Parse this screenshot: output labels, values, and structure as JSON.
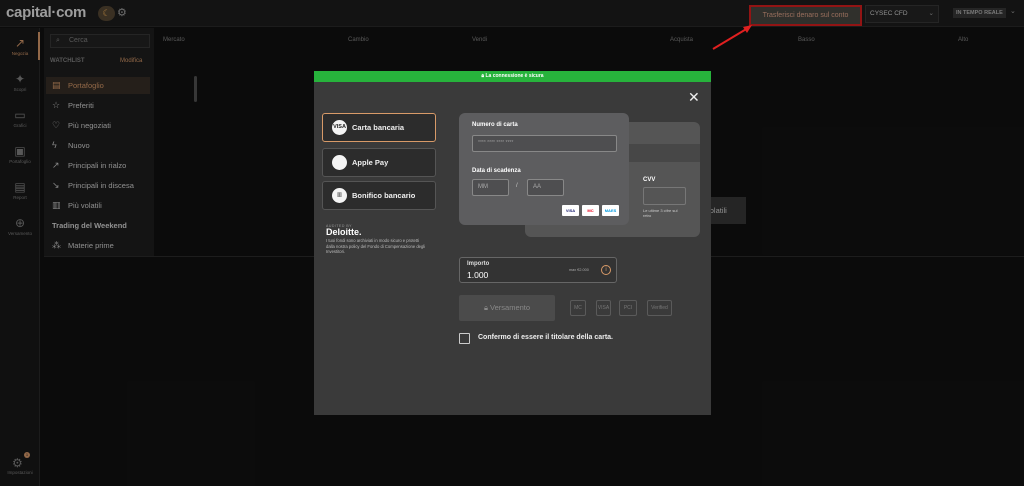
{
  "header": {
    "logo": "capital·com",
    "transfer_button": "Trasferisci denaro sul conto",
    "account": "CYSEC CFD",
    "realtime": "IN TEMPO REALE"
  },
  "rail": {
    "items": [
      {
        "label": "Negozia",
        "icon": "↗"
      },
      {
        "label": "Scopri",
        "icon": "✦"
      },
      {
        "label": "Grafici",
        "icon": "▭"
      },
      {
        "label": "Portafoglio",
        "icon": "▣"
      },
      {
        "label": "Report",
        "icon": "▤"
      },
      {
        "label": "Versamento",
        "icon": "⊕"
      }
    ],
    "settings_label": "Impostazioni",
    "settings_badge": "1"
  },
  "watchlist": {
    "search_placeholder": "Cerca",
    "heading": "WATCHLIST",
    "edit": "Modifica",
    "items": [
      {
        "label": "Portafoglio",
        "icon": "▤"
      },
      {
        "label": "Preferiti",
        "icon": "☆"
      },
      {
        "label": "Più negoziati",
        "icon": "♡"
      },
      {
        "label": "Nuovo",
        "icon": "ϟ"
      },
      {
        "label": "Principali in rialzo",
        "icon": "↗"
      },
      {
        "label": "Principali in discesa",
        "icon": "↘"
      },
      {
        "label": "Più volatili",
        "icon": "▥"
      },
      {
        "label": "Trading del Weekend",
        "icon": ""
      },
      {
        "label": "Materie prime",
        "icon": "⁂"
      }
    ]
  },
  "table": {
    "columns": [
      "Mercato",
      "Cambio",
      "Vendi",
      "Acquista",
      "Basso",
      "Alto"
    ]
  },
  "background": {
    "volatili_button": "volatili"
  },
  "modal": {
    "secure_text": "La connessione è sicura",
    "methods": [
      {
        "label": "Carta bancaria",
        "icon": "VISA"
      },
      {
        "label": "Apple Pay",
        "icon": ""
      },
      {
        "label": "Bonifico bancario",
        "icon": "▥"
      }
    ],
    "audited_by": "AUDITED BY",
    "deloitte": "Deloitte.",
    "deloitte_text": "I tuoi fondi sono archiviati in modo sicuro e protetti dalla nostra policy del Fondo di Compensazione degli Investitori.",
    "card_number_label": "Numero di carta",
    "card_number_placeholder": "**** **** **** ****",
    "expiry_label": "Data di scadenza",
    "mm_placeholder": "MM",
    "slash": "/",
    "aa_placeholder": "AA",
    "cvv_label": "CVV",
    "cvv_help": "Le ultime 3 cifre sul retro",
    "brands": [
      "VISA",
      "MC",
      "MAES"
    ],
    "amount_label": "Importo",
    "amount_value": "1.000",
    "amount_max": "max €2.000",
    "deposit_button": "Versamento",
    "pay_logos": [
      "MC",
      "VISA",
      "PCI",
      "Verified"
    ],
    "confirm_text": "Confermo di essere il titolare della carta."
  }
}
